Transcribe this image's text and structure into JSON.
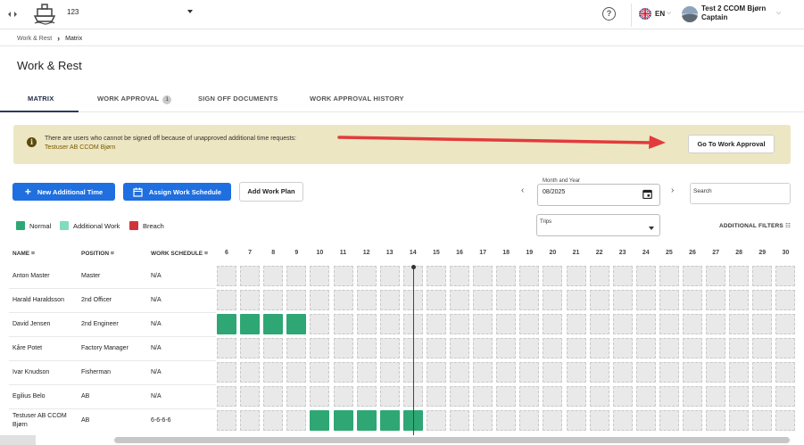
{
  "topbar": {
    "vessel_name": "123",
    "language": "EN",
    "user_name": "Test 2 CCOM Bjørn",
    "user_role": "Captain",
    "help_glyph": "?"
  },
  "breadcrumb": {
    "root": "Work & Rest",
    "current": "Matrix"
  },
  "page_title": "Work & Rest",
  "tabs": [
    {
      "label": "MATRIX",
      "active": true
    },
    {
      "label": "WORK APPROVAL",
      "badge": "1"
    },
    {
      "label": "SIGN OFF DOCUMENTS"
    },
    {
      "label": "WORK APPROVAL HISTORY"
    }
  ],
  "banner": {
    "message": "There are users who cannot be signed off because of unapproved additional time requests:",
    "user": "Testuser AB CCOM Bjørn",
    "button": "Go To Work Approval",
    "color": "#ece6c3"
  },
  "actions": {
    "new_additional_time": "New Additional Time",
    "assign_work_schedule": "Assign Work Schedule",
    "add_work_plan": "Add Work Plan"
  },
  "month": {
    "label": "Month and Year",
    "value": "08/2025"
  },
  "search": {
    "placeholder": "Search"
  },
  "trips": {
    "label": "Trips"
  },
  "additional_filters": "ADDITIONAL FILTERS",
  "legend": [
    {
      "label": "Normal",
      "color": "#2ea774"
    },
    {
      "label": "Additional Work",
      "color": "#7fdcc0"
    },
    {
      "label": "Breach",
      "color": "#d13438"
    }
  ],
  "columns": {
    "name": "NAME",
    "position": "POSITION",
    "work_schedule": "WORK SCHEDULE"
  },
  "days": [
    "6",
    "7",
    "8",
    "9",
    "10",
    "11",
    "12",
    "13",
    "14",
    "15",
    "16",
    "17",
    "18",
    "19",
    "20",
    "21",
    "22",
    "23",
    "24",
    "25",
    "26",
    "27",
    "28",
    "29",
    "30"
  ],
  "today": "14",
  "rows": [
    {
      "name": "Anton Master",
      "position": "Master",
      "schedule": "N/A",
      "normal_days": []
    },
    {
      "name": "Harald Haraldsson",
      "position": "2nd Officer",
      "schedule": "N/A",
      "normal_days": []
    },
    {
      "name": "David Jensen",
      "position": "2nd Engineer",
      "schedule": "N/A",
      "normal_days": [
        "6",
        "7",
        "8",
        "9"
      ]
    },
    {
      "name": "Kåre Potet",
      "position": "Factory Manager",
      "schedule": "N/A",
      "normal_days": []
    },
    {
      "name": "Ivar Knudson",
      "position": "Fisherman",
      "schedule": "N/A",
      "normal_days": []
    },
    {
      "name": "Egilius Belo",
      "position": "AB",
      "schedule": "N/A",
      "normal_days": []
    },
    {
      "name": "Testuser AB CCOM Bjørn",
      "position": "AB",
      "schedule": "6-6-6-6",
      "normal_days": [
        "10",
        "11",
        "12",
        "13",
        "14"
      ]
    }
  ]
}
